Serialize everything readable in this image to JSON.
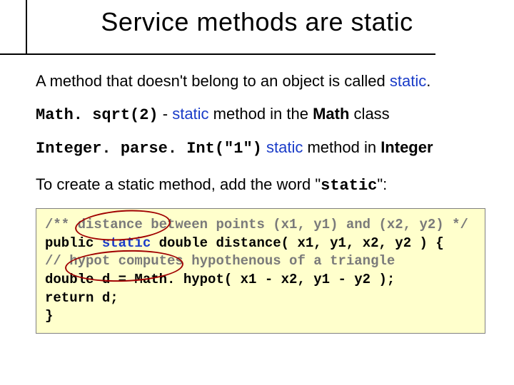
{
  "title": "Service methods are static",
  "intro": {
    "prefix": "A method that doesn't belong to an object is called ",
    "keyword": "static",
    "suffix": "."
  },
  "ex1": {
    "code": "Math. sqrt(2)",
    "sep_prefix": " - ",
    "kw": "static",
    "mid": " method in the ",
    "cls": "Math",
    "tail": " class"
  },
  "ex2": {
    "code": "Integer. parse. Int(\"1\")",
    "sep": " ",
    "kw": "static",
    "mid": " method in ",
    "cls": "Integer"
  },
  "howto": {
    "prefix": "To create a static method, add the word \"",
    "kw": "static",
    "suffix": "\":"
  },
  "code": {
    "l1_a": "/** distance between points (x1, y1) and (x2, y2) */",
    "l2_a": "public ",
    "l2_b": "static",
    "l2_c": " double distance( x1, y1, x2, y2 ) {",
    "l3_a": "// hypot computes hypothenous of a triangle",
    "l4_a": "double d = Math. hypot( x1 - x2, y1 - y2 );",
    "l5_a": "return d;",
    "l6_a": "}"
  }
}
